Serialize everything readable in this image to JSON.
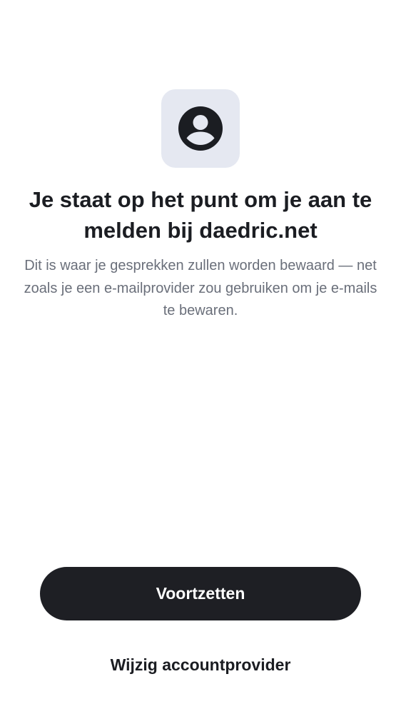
{
  "header": {
    "icon": "user-circle-icon",
    "title": "Je staat op het punt om je aan te melden bij daedric.net",
    "subtitle": "Dit is waar je gesprekken zullen worden bewaard — net zoals je een e-mailprovider zou gebruiken om je e-mails te bewaren."
  },
  "actions": {
    "continue_label": "Voortzetten",
    "change_provider_label": "Wijzig accountprovider"
  },
  "colors": {
    "icon_tile_background": "#e5e8f1",
    "primary_button_background": "#1e1f24",
    "primary_button_text": "#ffffff",
    "title_text": "#1b1d22",
    "subtitle_text": "#6a6f7a"
  }
}
